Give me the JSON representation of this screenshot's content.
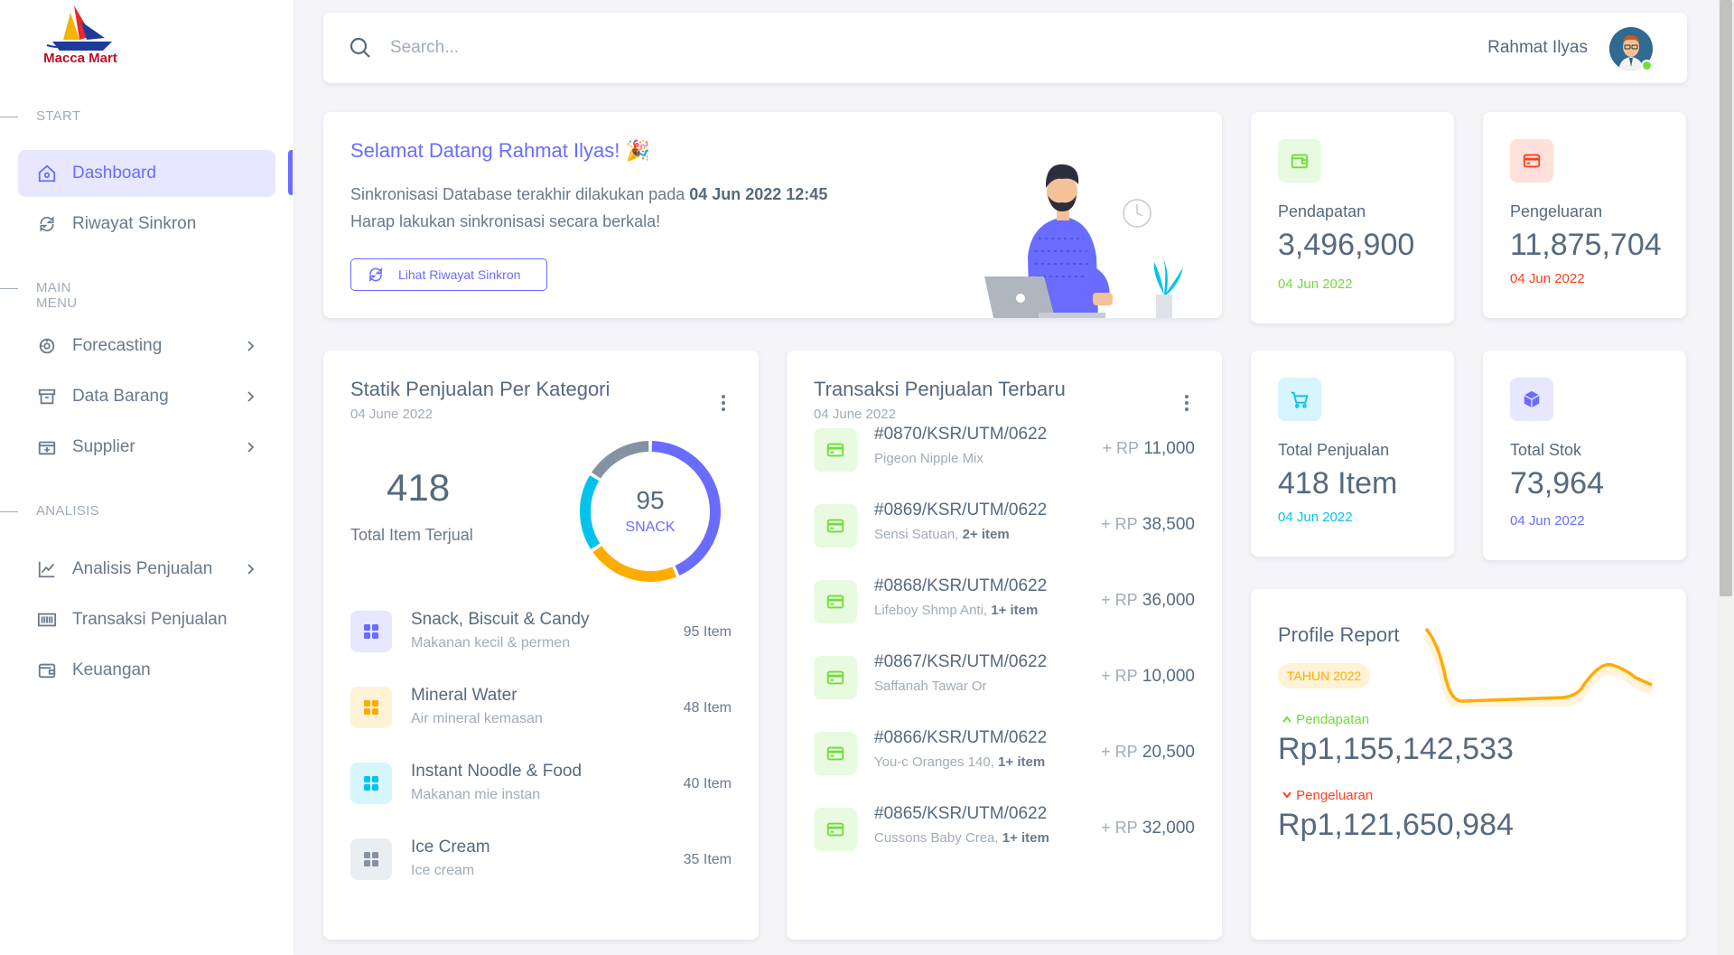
{
  "brand": {
    "name": "Macca Mart"
  },
  "sidebar": {
    "headers": [
      "START",
      "MAIN MENU",
      "ANALISIS"
    ],
    "items": [
      {
        "label": "Dashboard",
        "icon": "home-icon",
        "active": true
      },
      {
        "label": "Riwayat Sinkron",
        "icon": "sync-icon"
      },
      {
        "label": "Forecasting",
        "icon": "forecast-icon",
        "submenu": true
      },
      {
        "label": "Data Barang",
        "icon": "archive-icon",
        "submenu": true
      },
      {
        "label": "Supplier",
        "icon": "package-icon",
        "submenu": true
      },
      {
        "label": "Analisis Penjualan",
        "icon": "line-chart-icon",
        "submenu": true
      },
      {
        "label": "Transaksi Penjualan",
        "icon": "barcode-icon"
      },
      {
        "label": "Keuangan",
        "icon": "wallet-icon"
      }
    ]
  },
  "topbar": {
    "search_placeholder": "Search...",
    "user_name": "Rahmat Ilyas",
    "user_status": "online"
  },
  "welcome": {
    "title": "Selamat Datang Rahmat Ilyas! 🎉",
    "line1_prefix": "Sinkronisasi Database terakhir dilakukan pada ",
    "line1_date": "04 Jun 2022 12:45",
    "line2": "Harap lakukan sinkronisasi secara berkala!",
    "button": "Lihat Riwayat Sinkron"
  },
  "stats": [
    {
      "label": "Pendapatan",
      "value": "3,496,900",
      "date": "04 Jun 2022",
      "color": "#71dd37",
      "bg": "#e8fadf",
      "icon": "wallet-icon"
    },
    {
      "label": "Pengeluaran",
      "value": "11,875,704",
      "date": "04 Jun 2022",
      "color": "#ff3e1d",
      "bg": "#ffe0db",
      "icon": "credit-card-icon"
    },
    {
      "label": "Total Penjualan",
      "value": "418 Item",
      "date": "04 Jun 2022",
      "color": "#03c3ec",
      "bg": "#d7f5fc",
      "icon": "cart-icon"
    },
    {
      "label": "Total Stok",
      "value": "73,964",
      "date": "04 Jun 2022",
      "color": "#696cff",
      "bg": "#e7e7ff",
      "icon": "box-icon"
    }
  ],
  "category": {
    "title": "Statik Penjualan Per Kategori",
    "date": "04 June 2022",
    "total": "418",
    "total_label": "Total Item Terjual",
    "donut_value": "95",
    "donut_label": "SNACK",
    "items": [
      {
        "name": "Snack, Biscuit & Candy",
        "desc": "Makanan kecil & permen",
        "count": "95 Item",
        "color": "#696cff",
        "bg": "#e7e7ff"
      },
      {
        "name": "Mineral Water",
        "desc": "Air mineral kemasan",
        "count": "48 Item",
        "color": "#ffab00",
        "bg": "#fff2d6"
      },
      {
        "name": "Instant Noodle & Food",
        "desc": "Makanan mie instan",
        "count": "40 Item",
        "color": "#03c3ec",
        "bg": "#d7f5fc"
      },
      {
        "name": "Ice Cream",
        "desc": "Ice cream",
        "count": "35 Item",
        "color": "#8592a3",
        "bg": "#ebeef0"
      }
    ]
  },
  "transactions": {
    "title": "Transaksi Penjualan Terbaru",
    "date": "04 June 2022",
    "currency_prefix": "+ RP",
    "items": [
      {
        "id": "#0870/KSR/UTM/0622",
        "desc": "Pigeon Nipple Mix",
        "extra": "",
        "amount": "11,000"
      },
      {
        "id": "#0869/KSR/UTM/0622",
        "desc": "Sensi Satuan, ",
        "extra": "2+ item",
        "amount": "38,500"
      },
      {
        "id": "#0868/KSR/UTM/0622",
        "desc": "Lifeboy Shmp Anti, ",
        "extra": "1+ item",
        "amount": "36,000"
      },
      {
        "id": "#0867/KSR/UTM/0622",
        "desc": "Saffanah Tawar Or",
        "extra": "",
        "amount": "10,000"
      },
      {
        "id": "#0866/KSR/UTM/0622",
        "desc": "You-c Oranges 140, ",
        "extra": "1+ item",
        "amount": "20,500"
      },
      {
        "id": "#0865/KSR/UTM/0622",
        "desc": "Cussons Baby Crea, ",
        "extra": "1+ item",
        "amount": "32,000"
      }
    ]
  },
  "profile": {
    "title": "Profile Report",
    "badge": "TAHUN 2022",
    "income_label": "Pendapatan",
    "income_value": "Rp1,155,142,533",
    "expense_label": "Pengeluaran",
    "expense_value": "Rp1,121,650,984",
    "line_color": "#ffab00"
  },
  "chart_data": {
    "type": "pie",
    "categories": [
      "Snack, Biscuit & Candy",
      "Mineral Water",
      "Instant Noodle & Food",
      "Ice Cream"
    ],
    "values": [
      95,
      48,
      40,
      35
    ],
    "colors": [
      "#696cff",
      "#ffab00",
      "#03c3ec",
      "#8592a3"
    ]
  }
}
